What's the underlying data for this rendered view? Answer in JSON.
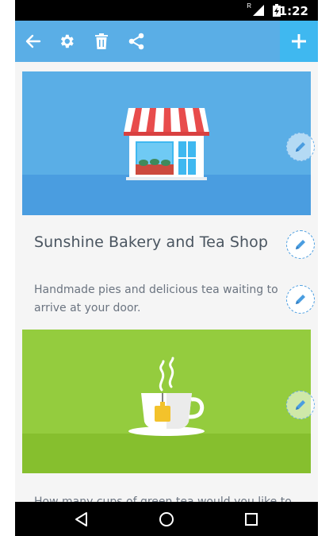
{
  "status_bar": {
    "time": "1:22",
    "signal_badge": "R"
  },
  "toolbar": {
    "icons": [
      "back-arrow-icon",
      "gear-icon",
      "trash-icon",
      "share-icon",
      "plus-icon"
    ],
    "accent_color": "#5aaee6",
    "add_color": "#3fb8f0"
  },
  "card": {
    "title": "Sunshine Bakery and Tea Shop",
    "description": "Handmade pies and delicious tea waiting to arrive at your door.",
    "question": "How many cups of green tea would you like to"
  },
  "images": {
    "shop_bg": "#5aaee6",
    "tea_bg": "#94cc3e"
  },
  "navigation": {
    "icons": [
      "back-triangle-icon",
      "home-circle-icon",
      "recents-square-icon"
    ]
  }
}
